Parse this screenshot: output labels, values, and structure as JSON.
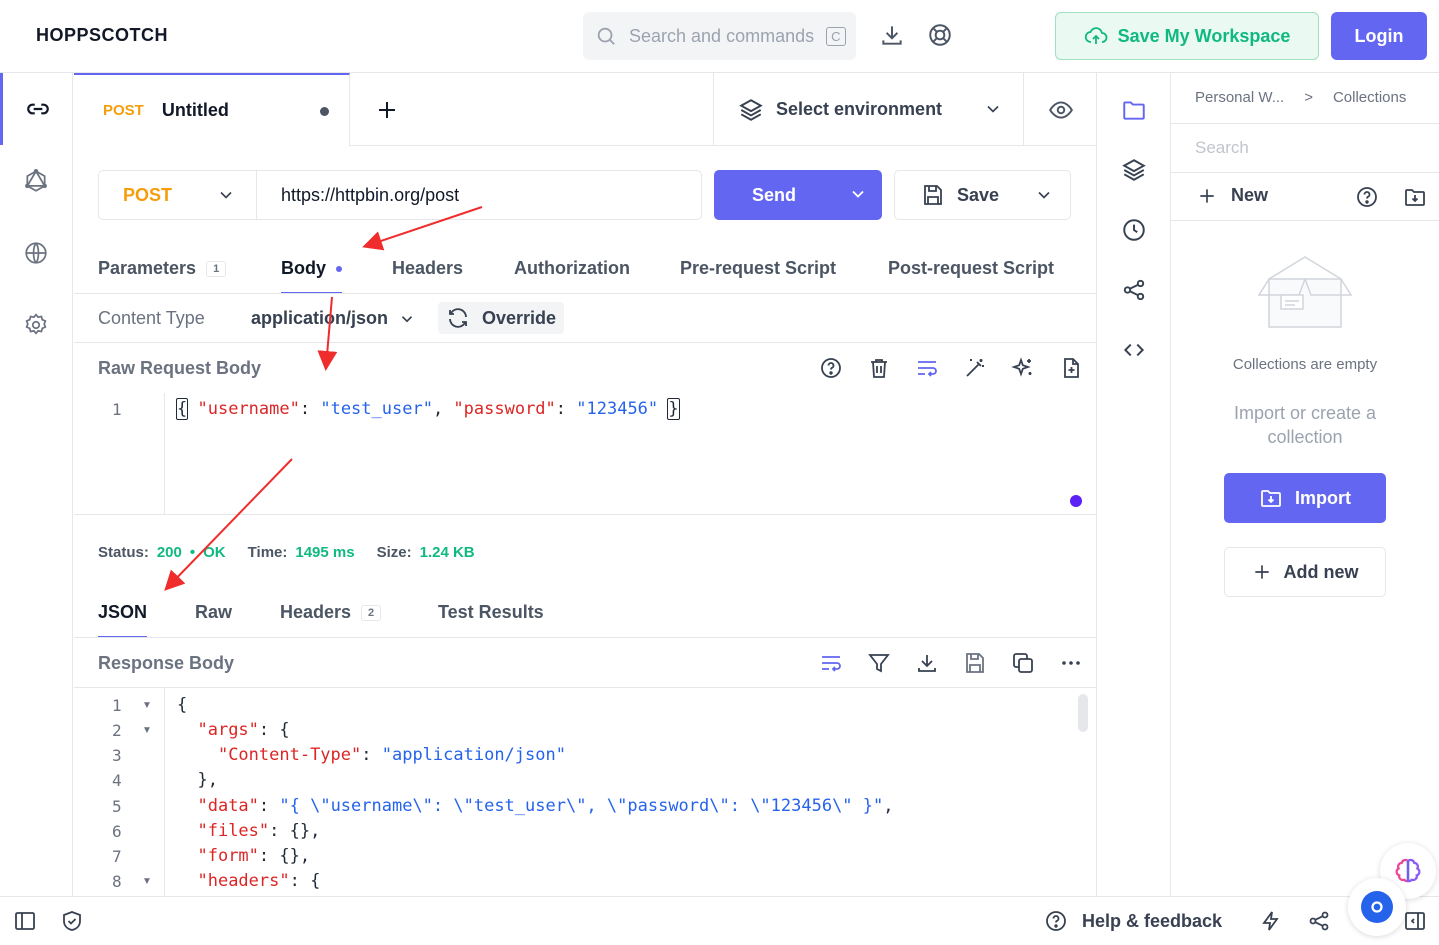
{
  "app": {
    "name": "HOPPSCOTCH"
  },
  "header": {
    "search_placeholder": "Search and commands",
    "search_kbd": "C",
    "save_workspace": "Save My Workspace",
    "login": "Login"
  },
  "tab": {
    "method": "POST",
    "title": "Untitled"
  },
  "environment": {
    "label": "Select environment"
  },
  "request": {
    "method": "POST",
    "url": "https://httpbin.org/post",
    "send": "Send",
    "save": "Save"
  },
  "request_tabs": [
    {
      "label": "Parameters",
      "badge": "1"
    },
    {
      "label": "Body"
    },
    {
      "label": "Headers"
    },
    {
      "label": "Authorization"
    },
    {
      "label": "Pre-request Script"
    },
    {
      "label": "Post-request Script"
    }
  ],
  "content_type": {
    "label": "Content Type",
    "value": "application/json",
    "override": "Override"
  },
  "raw_body": {
    "label": "Raw Request Body",
    "line": "1",
    "tokens": [
      "{",
      "\"username\"",
      ": ",
      "\"test_user\"",
      ", ",
      "\"password\"",
      ": ",
      "\"123456\"",
      " ",
      "}"
    ]
  },
  "status": {
    "status_label": "Status:",
    "status_code": "200",
    "status_text": "OK",
    "time_label": "Time:",
    "time_value": "1495 ms",
    "size_label": "Size:",
    "size_value": "1.24 KB"
  },
  "response_tabs": [
    {
      "label": "JSON"
    },
    {
      "label": "Raw"
    },
    {
      "label": "Headers",
      "badge": "2"
    },
    {
      "label": "Test Results"
    }
  ],
  "response": {
    "label": "Response Body",
    "lines": [
      {
        "n": "1",
        "text": "{"
      },
      {
        "n": "2",
        "key": "\"args\"",
        "rest": ": {"
      },
      {
        "n": "3",
        "key": "\"Content-Type\"",
        "sep": ": ",
        "val": "\"application/json\""
      },
      {
        "n": "4",
        "text": "},"
      },
      {
        "n": "5",
        "key": "\"data\"",
        "sep": ": ",
        "val": "\"{ \\\"username\\\": \\\"test_user\\\", \\\"password\\\": \\\"123456\\\" }\"",
        "rest": ","
      },
      {
        "n": "6",
        "key": "\"files\"",
        "rest": ": {},"
      },
      {
        "n": "7",
        "key": "\"form\"",
        "rest": ": {},"
      },
      {
        "n": "8",
        "key": "\"headers\"",
        "rest": ": {"
      }
    ]
  },
  "collections": {
    "breadcrumb_1": "Personal W...",
    "breadcrumb_sep": ">",
    "breadcrumb_2": "Collections",
    "search_placeholder": "Search",
    "new": "New",
    "empty_title": "Collections are empty",
    "empty_sub": "Import or create a collection",
    "import": "Import",
    "add_new": "Add new"
  },
  "footer": {
    "help": "Help & feedback"
  },
  "colors": {
    "accent": "#6366f1",
    "method": "#f59e0b",
    "success": "#10b981",
    "key": "#dc2626",
    "string": "#2563eb"
  }
}
